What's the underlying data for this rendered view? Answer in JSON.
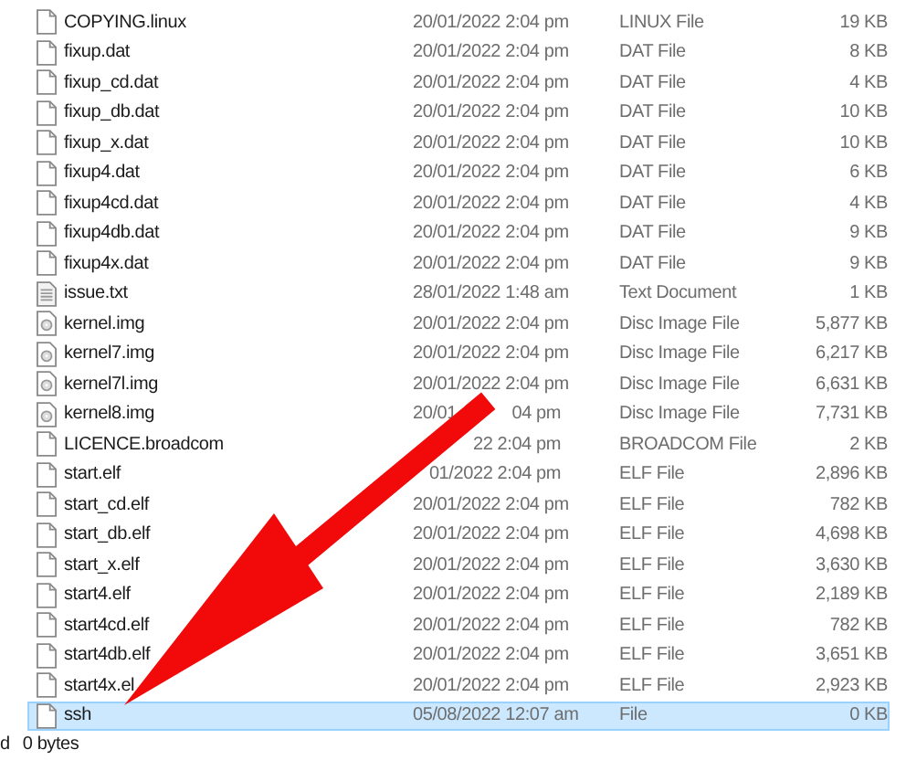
{
  "files": [
    {
      "name": "COPYING.linux",
      "date": "20/01/2022 2:04 pm",
      "type": "LINUX File",
      "size": "19 KB",
      "kind": "file",
      "selected": false
    },
    {
      "name": "fixup.dat",
      "date": "20/01/2022 2:04 pm",
      "type": "DAT File",
      "size": "8 KB",
      "kind": "file",
      "selected": false
    },
    {
      "name": "fixup_cd.dat",
      "date": "20/01/2022 2:04 pm",
      "type": "DAT File",
      "size": "4 KB",
      "kind": "file",
      "selected": false
    },
    {
      "name": "fixup_db.dat",
      "date": "20/01/2022 2:04 pm",
      "type": "DAT File",
      "size": "10 KB",
      "kind": "file",
      "selected": false
    },
    {
      "name": "fixup_x.dat",
      "date": "20/01/2022 2:04 pm",
      "type": "DAT File",
      "size": "10 KB",
      "kind": "file",
      "selected": false
    },
    {
      "name": "fixup4.dat",
      "date": "20/01/2022 2:04 pm",
      "type": "DAT File",
      "size": "6 KB",
      "kind": "file",
      "selected": false
    },
    {
      "name": "fixup4cd.dat",
      "date": "20/01/2022 2:04 pm",
      "type": "DAT File",
      "size": "4 KB",
      "kind": "file",
      "selected": false
    },
    {
      "name": "fixup4db.dat",
      "date": "20/01/2022 2:04 pm",
      "type": "DAT File",
      "size": "9 KB",
      "kind": "file",
      "selected": false
    },
    {
      "name": "fixup4x.dat",
      "date": "20/01/2022 2:04 pm",
      "type": "DAT File",
      "size": "9 KB",
      "kind": "file",
      "selected": false
    },
    {
      "name": "issue.txt",
      "date": "28/01/2022 1:48 am",
      "type": "Text Document",
      "size": "1 KB",
      "kind": "text",
      "selected": false
    },
    {
      "name": "kernel.img",
      "date": "20/01/2022 2:04 pm",
      "type": "Disc Image File",
      "size": "5,877 KB",
      "kind": "disc",
      "selected": false
    },
    {
      "name": "kernel7.img",
      "date": "20/01/2022 2:04 pm",
      "type": "Disc Image File",
      "size": "6,217 KB",
      "kind": "disc",
      "selected": false
    },
    {
      "name": "kernel7l.img",
      "date": "20/01/2022 2:04 pm",
      "type": "Disc Image File",
      "size": "6,631 KB",
      "kind": "disc",
      "selected": false
    },
    {
      "name": "kernel8.img",
      "date_left": "20/01",
      "date": "04 pm",
      "type": "Disc Image File",
      "size": "7,731 KB",
      "kind": "disc",
      "selected": false
    },
    {
      "name": "LICENCE.broadcom",
      "date": "22 2:04 pm",
      "type": "BROADCOM File",
      "size": "2 KB",
      "kind": "file",
      "selected": false
    },
    {
      "name": "start.elf",
      "date": "01/2022 2:04 pm",
      "type": "ELF File",
      "size": "2,896 KB",
      "kind": "file",
      "selected": false
    },
    {
      "name": "start_cd.elf",
      "date": "20/01/2022 2:04 pm",
      "type": "ELF File",
      "size": "782 KB",
      "kind": "file",
      "selected": false
    },
    {
      "name": "start_db.elf",
      "date": "20/01/2022 2:04 pm",
      "type": "ELF File",
      "size": "4,698 KB",
      "kind": "file",
      "selected": false
    },
    {
      "name": "start_x.elf",
      "date": "20/01/2022 2:04 pm",
      "type": "ELF File",
      "size": "3,630 KB",
      "kind": "file",
      "selected": false
    },
    {
      "name": "start4.elf",
      "date": "20/01/2022 2:04 pm",
      "type": "ELF File",
      "size": "2,189 KB",
      "kind": "file",
      "selected": false
    },
    {
      "name": "start4cd.elf",
      "date": "20/01/2022 2:04 pm",
      "type": "ELF File",
      "size": "782 KB",
      "kind": "file",
      "selected": false
    },
    {
      "name": "start4db.elf",
      "date": "20/01/2022 2:04 pm",
      "type": "ELF File",
      "size": "3,651 KB",
      "kind": "file",
      "selected": false
    },
    {
      "name": "start4x.el",
      "date": "20/01/2022 2:04 pm",
      "type": "ELF File",
      "size": "2,923 KB",
      "kind": "file",
      "selected": false
    },
    {
      "name": "ssh",
      "date": "05/08/2022 12:07 am",
      "type": "File",
      "size": "0 KB",
      "kind": "file",
      "selected": true
    }
  ],
  "status_bar": {
    "selection": "d",
    "size": "0 bytes"
  }
}
